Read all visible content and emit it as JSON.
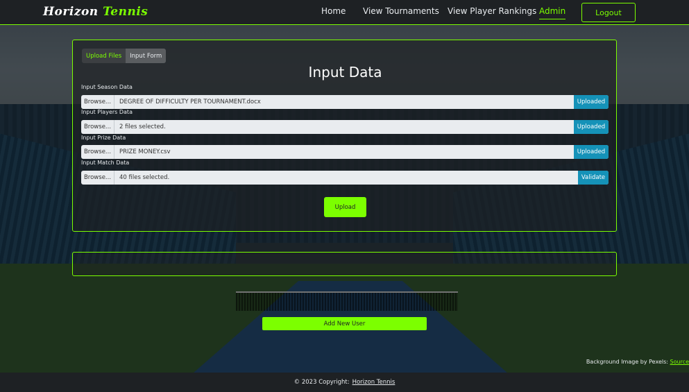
{
  "navbar": {
    "brand_part1": "Horizon",
    "brand_part2": "Tennis",
    "links": [
      "Home",
      "View Tournaments",
      "View Player Rankings",
      "Admin"
    ],
    "active_link": "Admin",
    "logout_label": "Logout"
  },
  "card": {
    "tabs": [
      "Upload Files",
      "Input Form"
    ],
    "active_tab": "Upload Files",
    "title": "Input Data",
    "fields": [
      {
        "label": "Input Season Data",
        "browse": "Browse...",
        "file": "DEGREE OF DIFFICULTY PER TOURNAMENT.docx",
        "status": "Uploaded"
      },
      {
        "label": "Input Players Data",
        "browse": "Browse...",
        "file": "2 files selected.",
        "status": "Uploaded"
      },
      {
        "label": "Input Prize Data",
        "browse": "Browse...",
        "file": "PRIZE MONEY.csv",
        "status": "Uploaded"
      },
      {
        "label": "Input Match Data",
        "browse": "Browse...",
        "file": "40 files selected.",
        "status": "Validate"
      }
    ],
    "upload_label": "Upload"
  },
  "add_user_label": "Add New User",
  "credit": {
    "text": "Background Image by Pexels:",
    "link": "Source"
  },
  "footer": {
    "text": "© 2023 Copyright:",
    "link": "Horizon Tennis"
  },
  "colors": {
    "accent": "#7cff00",
    "nav_bg": "#1e2124",
    "status_blue": "#1592b8"
  },
  "background_icon": "tennis-stadium-photo"
}
